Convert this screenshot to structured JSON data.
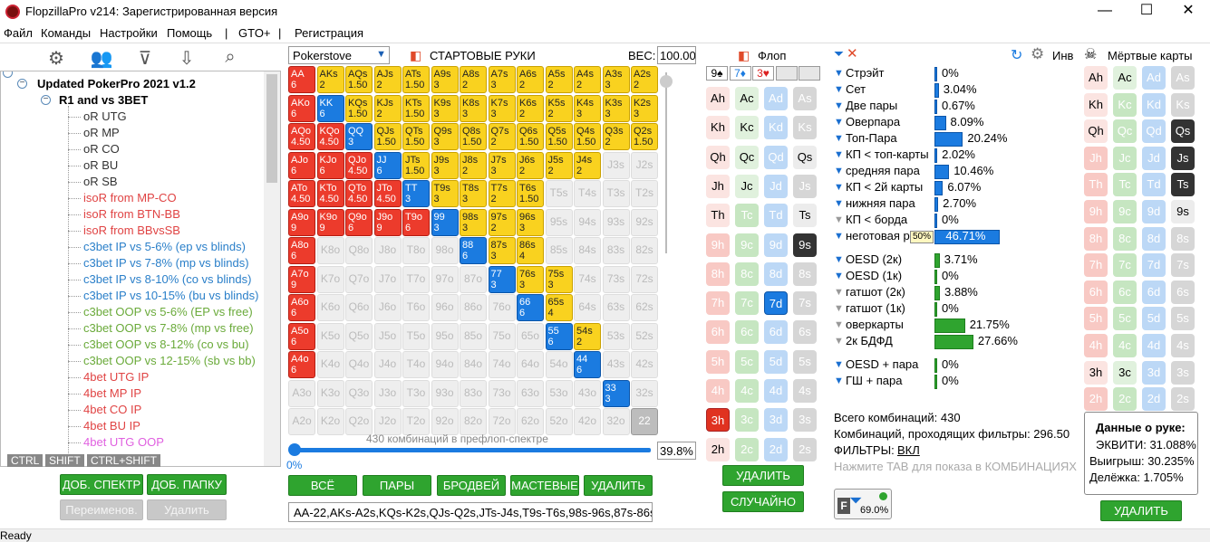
{
  "window": {
    "title": "FlopzillaPro v214: Зарегистрированная версия"
  },
  "menu": [
    "Файл",
    "Команды",
    "Настройки",
    "Помощь",
    "|",
    "GTO+",
    "|",
    "Регистрация"
  ],
  "tree": {
    "root": "Updated PokerPro 2021 v1.2",
    "folder": "R1 and vs 3BET",
    "items": [
      {
        "label": "oR UTG",
        "color": "#333333"
      },
      {
        "label": "oR MP",
        "color": "#333333"
      },
      {
        "label": "oR CO",
        "color": "#333333"
      },
      {
        "label": "oR BU",
        "color": "#333333"
      },
      {
        "label": "oR SB",
        "color": "#333333"
      },
      {
        "label": "isoR from MP-CO",
        "color": "#e04444"
      },
      {
        "label": "isoR from BTN-BB",
        "color": "#e04444"
      },
      {
        "label": "isoR from BBvsSB",
        "color": "#e04444"
      },
      {
        "label": "c3bet IP vs 5-6% (ep vs blinds)",
        "color": "#2a7fc9"
      },
      {
        "label": "c3bet IP vs 7-8% (mp vs blinds)",
        "color": "#2a7fc9"
      },
      {
        "label": "c3bet IP vs 8-10% (co vs blinds)",
        "color": "#2a7fc9"
      },
      {
        "label": "c3bet IP vs 10-15% (bu vs blinds)",
        "color": "#2a7fc9"
      },
      {
        "label": "c3bet OOP vs 5-6% (EP vs free)",
        "color": "#6aaa3a"
      },
      {
        "label": "c3bet OOP vs 7-8% (mp vs free)",
        "color": "#6aaa3a"
      },
      {
        "label": "c3bet OOP vs 8-12% (co vs bu)",
        "color": "#6aaa3a"
      },
      {
        "label": "c3bet OOP vs 12-15% (sb vs bb)",
        "color": "#6aaa3a"
      },
      {
        "label": "4bet UTG IP",
        "color": "#e04444"
      },
      {
        "label": "4bet MP IP",
        "color": "#e04444"
      },
      {
        "label": "4bet CO IP",
        "color": "#e04444"
      },
      {
        "label": "4bet BU IP",
        "color": "#e04444"
      },
      {
        "label": "4bet UTG OOP",
        "color": "#e060e0"
      }
    ]
  },
  "keys": [
    "CTRL",
    "SHIFT",
    "CTRL+SHIFT"
  ],
  "left_buttons": {
    "add_range": "ДОБ. СПЕКТР",
    "add_folder": "ДОБ. ПАПКУ",
    "rename": "Переименов.",
    "delete": "Удалить"
  },
  "range": {
    "select_value": "Pokerstove",
    "title": "СТАРТОВЫЕ РУКИ",
    "weight_label": "ВЕС:",
    "weight_value": "100.00",
    "combos_text": "430 комбинаций в префлоп-спектре",
    "slider_min": "0%",
    "slider_value": "39.8%",
    "buttons": [
      "ВСЁ",
      "ПАРЫ",
      "БРОДВЕЙ",
      "МАСТЕВЫЕ",
      "УДАЛИТЬ"
    ],
    "text": "AA-22,AKs-A2s,KQs-K2s,QJs-Q2s,JTs-J4s,T9s-T6s,98s-96s,87s-86s,7"
  },
  "grid": [
    [
      "AA|6|r",
      "AKs|2|y",
      "AQs|1.50|y",
      "AJs|2|y",
      "ATs|1.50|y",
      "A9s|3|y",
      "A8s|2|y",
      "A7s|3|y",
      "A6s|2|y",
      "A5s|2|y",
      "A4s|2|y",
      "A3s|3|y",
      "A2s|2|y"
    ],
    [
      "AKo|6|r",
      "KK|6|b",
      "KQs|1.50|y",
      "KJs|2|y",
      "KTs|1.50|y",
      "K9s|3|y",
      "K8s|3|y",
      "K7s|3|y",
      "K6s|2|y",
      "K5s|2|y",
      "K4s|3|y",
      "K3s|3|y",
      "K2s|3|y"
    ],
    [
      "AQo|4.50|r",
      "KQo|4.50|r",
      "QQ|3|b",
      "QJs|1.50|y",
      "QTs|1.50|y",
      "Q9s|3|y",
      "Q8s|1.50|y",
      "Q7s|2|y",
      "Q6s|1.50|y",
      "Q5s|1.50|y",
      "Q4s|1.50|y",
      "Q3s|2|y",
      "Q2s|1.50|y"
    ],
    [
      "AJo|6|r",
      "KJo|6|r",
      "QJo|4.50|r",
      "JJ|6|b",
      "JTs|1.50|y",
      "J9s|3|y",
      "J8s|2|y",
      "J7s|3|y",
      "J6s|2|y",
      "J5s|2|y",
      "J4s|2|y",
      "J3s||e",
      "J2s||e"
    ],
    [
      "ATo|4.50|r",
      "KTo|4.50|r",
      "QTo|4.50|r",
      "JTo|4.50|r",
      "TT|3|b",
      "T9s|3|y",
      "T8s|3|y",
      "T7s|2|y",
      "T6s|1.50|y",
      "T5s||e",
      "T4s||e",
      "T3s||e",
      "T2s||e"
    ],
    [
      "A9o|9|r",
      "K9o|9|r",
      "Q9o|6|r",
      "J9o|9|r",
      "T9o|6|r",
      "99|3|b",
      "98s|3|y",
      "97s|2|y",
      "96s|3|y",
      "95s||e",
      "94s||e",
      "93s||e",
      "92s||e"
    ],
    [
      "A8o|6|r",
      "K8o||e",
      "Q8o||e",
      "J8o||e",
      "T8o||e",
      "98o||e",
      "88|6|b",
      "87s|3|y",
      "86s|4|y",
      "85s||e",
      "84s||e",
      "83s||e",
      "82s||e"
    ],
    [
      "A7o|9|r",
      "K7o||e",
      "Q7o||e",
      "J7o||e",
      "T7o||e",
      "97o||e",
      "87o||e",
      "77|3|b",
      "76s|3|y",
      "75s|3|y",
      "74s||e",
      "73s||e",
      "72s||e"
    ],
    [
      "A6o|6|r",
      "K6o||e",
      "Q6o||e",
      "J6o||e",
      "T6o||e",
      "96o||e",
      "86o||e",
      "76o||e",
      "66|6|b",
      "65s|4|y",
      "64s||e",
      "63s||e",
      "62s||e"
    ],
    [
      "A5o|6|r",
      "K5o||e",
      "Q5o||e",
      "J5o||e",
      "T5o||e",
      "95o||e",
      "85o||e",
      "75o||e",
      "65o||e",
      "55|6|b",
      "54s|2|y",
      "53s||e",
      "52s||e"
    ],
    [
      "A4o|6|r",
      "K4o||e",
      "Q4o||e",
      "J4o||e",
      "T4o||e",
      "94o||e",
      "84o||e",
      "74o||e",
      "64o||e",
      "54o||e",
      "44|6|b",
      "43s||e",
      "42s||e"
    ],
    [
      "A3o||e",
      "K3o||e",
      "Q3o||e",
      "J3o||e",
      "T3o||e",
      "93o||e",
      "83o||e",
      "73o||e",
      "63o||e",
      "53o||e",
      "43o||e",
      "33|3|b",
      "32s||e"
    ],
    [
      "A2o||e",
      "K2o||e",
      "Q2o||e",
      "J2o||e",
      "T2o||e",
      "92o||e",
      "82o||e",
      "72o||e",
      "62o||e",
      "52o||e",
      "42o||e",
      "32o||e",
      "22||g"
    ]
  ],
  "flop": {
    "title": "Флоп",
    "slots": [
      "9♠",
      "7♦",
      "3♥",
      "",
      ""
    ],
    "columns": [
      [
        "Ah|chf",
        "Kh|chf",
        "Qh|chf",
        "Jh|chf",
        "Th|chf",
        "9h|ch",
        "8h|ch",
        "7h|ch",
        "6h|ch",
        "5h|ch",
        "4h|ch",
        "3h|chs",
        "2h|chf"
      ],
      [
        "Ac|ccf",
        "Kc|ccf",
        "Qc|ccf",
        "Jc|ccf",
        "Tc|cc",
        "9c|cc",
        "8c|cc",
        "7c|cc",
        "6c|cc",
        "5c|cc",
        "4c|cc",
        "3c|cc",
        "2c|cc"
      ],
      [
        "Ad|cd",
        "Kd|cd",
        "Qd|cd",
        "Jd|cd",
        "Td|cd",
        "9d|cd",
        "8d|cd",
        "7d|cds",
        "6d|cd",
        "5d|cd",
        "4d|cd",
        "3d|cd",
        "2d|cd"
      ],
      [
        "As|cs",
        "Ks|cs",
        "Qs|csf",
        "Js|cs",
        "Ts|csf",
        "9s|css",
        "8s|cs",
        "7s|cs",
        "6s|cs",
        "5s|cs",
        "4s|cs",
        "3s|cs",
        "2s|cs"
      ]
    ],
    "delete": "УДАЛИТЬ",
    "random": "СЛУЧАЙНО"
  },
  "stats": [
    {
      "label": "Стрэйт",
      "value": "0%",
      "pct": 0,
      "c": "b",
      "f": "b"
    },
    {
      "label": "Сет",
      "value": "3.04%",
      "pct": 3.04,
      "c": "b",
      "f": "b"
    },
    {
      "label": "Две пары",
      "value": "0.67%",
      "pct": 0.67,
      "c": "b",
      "f": "b"
    },
    {
      "label": "Оверпара",
      "value": "8.09%",
      "pct": 8.09,
      "c": "b",
      "f": "b"
    },
    {
      "label": "Топ-Пара",
      "value": "20.24%",
      "pct": 20.24,
      "c": "b",
      "f": "b"
    },
    {
      "label": "КП < топ-карты",
      "value": "2.02%",
      "pct": 2.02,
      "c": "b",
      "f": "b"
    },
    {
      "label": "средняя пара",
      "value": "10.46%",
      "pct": 10.46,
      "c": "b",
      "f": "b"
    },
    {
      "label": "КП < 2й карты",
      "value": "6.07%",
      "pct": 6.07,
      "c": "b",
      "f": "b"
    },
    {
      "label": "нижняя пара",
      "value": "2.70%",
      "pct": 2.7,
      "c": "b",
      "f": "b"
    },
    {
      "label": "КП < борда",
      "value": "0%",
      "pct": 0,
      "c": "b",
      "f": "g"
    },
    {
      "label": "неготовая р",
      "value": "46.71%",
      "pct": 46.71,
      "c": "b",
      "f": "b",
      "badge": "50%"
    },
    {
      "gap": true
    },
    {
      "label": "OESD (2к)",
      "value": "3.71%",
      "pct": 3.71,
      "c": "g",
      "f": "b"
    },
    {
      "label": "OESD (1к)",
      "value": "0%",
      "pct": 0,
      "c": "g",
      "f": "b"
    },
    {
      "label": "гатшот (2к)",
      "value": "3.88%",
      "pct": 3.88,
      "c": "g",
      "f": "g"
    },
    {
      "label": "гатшот (1к)",
      "value": "0%",
      "pct": 0,
      "c": "g",
      "f": "g"
    },
    {
      "label": "оверкарты",
      "value": "21.75%",
      "pct": 21.75,
      "c": "g",
      "f": "g"
    },
    {
      "label": "2к БДФД",
      "value": "27.66%",
      "pct": 27.66,
      "c": "g",
      "f": "g"
    },
    {
      "gap": true
    },
    {
      "label": "OESD + пара",
      "value": "0%",
      "pct": 0,
      "c": "g",
      "f": "b"
    },
    {
      "label": "ГШ + пара",
      "value": "0%",
      "pct": 0,
      "c": "g",
      "f": "b"
    }
  ],
  "summary": {
    "total": "Всего комбинаций: 430",
    "passing": "Комбинаций, проходящих фильтры: 296.50",
    "filters_label": "ФИЛЬТРЫ:",
    "filters_value": "ВКЛ",
    "hint": "Нажмите TAB для показа в КОМБИНАЦИЯХ",
    "filter_pct": "69.0%"
  },
  "dead": {
    "inv": "Инв",
    "title": "Мёртвые карты",
    "columns": [
      [
        "Ah|chf",
        "Kh|chf",
        "Qh|chf",
        "Jh|ch",
        "Th|ch",
        "9h|ch",
        "8h|ch",
        "7h|ch",
        "6h|ch",
        "5h|ch",
        "4h|ch",
        "3h|chf",
        "2h|ch"
      ],
      [
        "Ac|ccf",
        "Kc|cc",
        "Qc|cc",
        "Jc|cc",
        "Tc|cc",
        "9c|cc",
        "8c|cc",
        "7c|cc",
        "6c|cc",
        "5c|cc",
        "4c|cc",
        "3c|ccf",
        "2c|cc"
      ],
      [
        "Ad|cd",
        "Kd|cd",
        "Qd|cd",
        "Jd|cd",
        "Td|cd",
        "9d|cd",
        "8d|cd",
        "7d|cd",
        "6d|cd",
        "5d|cd",
        "4d|cd",
        "3d|cd",
        "2d|cd"
      ],
      [
        "As|cs",
        "Ks|cs",
        "Qs|css",
        "Js|css",
        "Ts|css",
        "9s|csf",
        "8s|cs",
        "7s|cs",
        "6s|cs",
        "5s|cs",
        "4s|cs",
        "3s|cs",
        "2s|cs"
      ]
    ],
    "delete": "УДАЛИТЬ"
  },
  "hand_info": {
    "title": "Данные о руке:",
    "equity": "ЭКВИТИ: 31.088%",
    "win": "Выигрыш: 30.235%",
    "tie": "Делёжка: 1.705%"
  },
  "status": "Ready"
}
